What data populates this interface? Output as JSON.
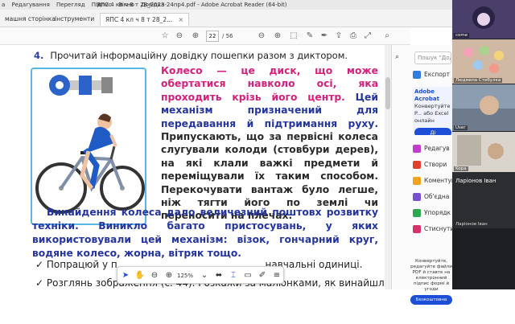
{
  "window": {
    "menu_items": [
      "а",
      "Редагування",
      "Перегляд",
      "Підпис",
      "Вікно",
      "Довідка"
    ],
    "title": "ЯПС 4 кл ч 8 т 28_2023-24пр4.pdf - Adobe Acrobat Reader (64-bit)"
  },
  "tabs": {
    "home": "машня сторінка",
    "tools": "Інструменти",
    "document": "ЯПС 4 кл ч 8 т 28_2..."
  },
  "toolbar": {
    "current_page": "22",
    "total_pages": "/ 56"
  },
  "document": {
    "task_number": "4.",
    "task_text": "Прочитай інформаційну довідку пошепки разом з диктором.",
    "para1_pink": "Колесо — це диск, що може обертатися навколо осі, яка проходить крізь його центр.",
    "para1_blue": "Цей механізм призначений для передавання й підтримання руху.",
    "para1_dark": "Припускають, що за первісні колеса слугували колоди (стовбури дерев), на які клали важкі предмети й переміщували їх таким способом. Перекочувати вантаж було легше, ніж тягти його по землі чи переносити на плечах.",
    "para2": "Винайдення колеса дало величезний поштовх розвитку техніки. Виникло багато пристосувань, у яких використовували цей механізм: візок, гончарний круг, водяне колесо, жорна, вітряк тощо.",
    "bullet1": "Попрацюй у п",
    "bullet1_end": "навчальні одиниці.",
    "bullet2": "Розглянь зображення (с. 44). Розкажи за малюнками, як винайшли"
  },
  "floatbar": {
    "zoom": "125%"
  },
  "right_panel": {
    "search_placeholder": "Пошук \"Додат",
    "items": [
      {
        "label": "Експорт",
        "color": "#2f7de1"
      },
      {
        "label": "Редагув",
        "color": "#c13ecb"
      },
      {
        "label": "Створи",
        "color": "#e0412f"
      },
      {
        "label": "Коментув",
        "color": "#f2a31b"
      },
      {
        "label": "Об'єдна",
        "color": "#7a4fd1"
      },
      {
        "label": "Упорядк",
        "color": "#2ea84f"
      },
      {
        "label": "Стиснути PDF",
        "color": "#d6336c"
      }
    ],
    "promo_title": "Adobe Acrobat",
    "promo_text": "Конвертуйте P... або Excel онлайн",
    "promo_button": "Ді",
    "bottom_text": "Конвертуйте, редагуйте файли PDF й ставте на електронний підпис формі й угоди",
    "bottom_button": "Безкоштовна пробна версія на 7 днів"
  },
  "video_call": {
    "tiles": [
      {
        "name": "come",
        "bg": "#4a3f6b"
      },
      {
        "name": "Людмила Стебулка",
        "bg": "#cfb8a4"
      },
      {
        "name": "User",
        "bg": "#8d9db0"
      },
      {
        "name": "Kopa",
        "bg": "#d9d4cc"
      }
    ],
    "main_label": "Ларіонов Іван",
    "main_sub": "Ларіонов Іван"
  }
}
